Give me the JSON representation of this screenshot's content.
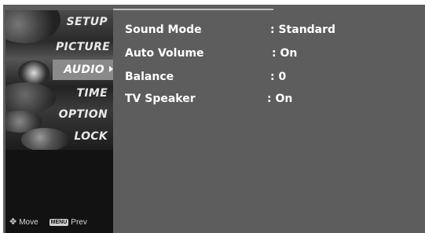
{
  "menu": {
    "items": [
      {
        "label": "SETUP",
        "active": false
      },
      {
        "label": "PICTURE",
        "active": false
      },
      {
        "label": "AUDIO",
        "active": true
      },
      {
        "label": "TIME",
        "active": false
      },
      {
        "label": "OPTION",
        "active": false
      },
      {
        "label": "LOCK",
        "active": false
      }
    ]
  },
  "footer": {
    "move_icon": "four-way-arrow-icon",
    "move_label": "Move",
    "menu_key": "MENU",
    "prev_label": "Prev"
  },
  "settings": [
    {
      "label": "Sound Mode",
      "value": ": Standard"
    },
    {
      "label": "Auto Volume",
      "value": ": On"
    },
    {
      "label": "Balance",
      "value": ": 0"
    },
    {
      "label": "TV Speaker",
      "value": ": On"
    }
  ],
  "colors": {
    "panel": "#5d5d5d",
    "sidebar": "#121212",
    "highlight": "#8a8a8a",
    "text": "#ffffff"
  }
}
